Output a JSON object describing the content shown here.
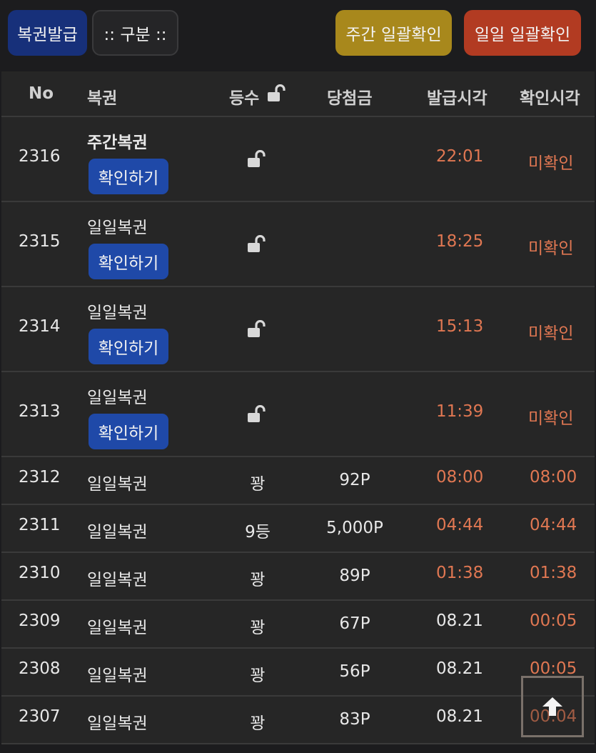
{
  "toolbar": {
    "issue_label": "복권발급",
    "category_label": ":: 구분 ::",
    "weekly_confirm_label": "주간 일괄확인",
    "daily_confirm_label": "일일 일괄확인"
  },
  "colors": {
    "issue_button": "#17307a",
    "weekly_button": "#a8881c",
    "daily_button": "#b23b22",
    "confirm_button": "#1f49a8",
    "accent_time": "#e07752"
  },
  "table": {
    "headers": {
      "no": "No",
      "ticket": "복권",
      "rank": "등수",
      "prize": "당첨금",
      "issued_at": "발급시각",
      "checked_at": "확인시각"
    },
    "unconfirmed_rows": [
      {
        "no": "2316",
        "type": "주간복권",
        "button": "확인하기",
        "rank_icon": "unlock-icon",
        "issued_at": "22:01",
        "checked_at": "미확인"
      },
      {
        "no": "2315",
        "type": "일일복권",
        "button": "확인하기",
        "rank_icon": "unlock-icon",
        "issued_at": "18:25",
        "checked_at": "미확인"
      },
      {
        "no": "2314",
        "type": "일일복권",
        "button": "확인하기",
        "rank_icon": "unlock-icon",
        "issued_at": "15:13",
        "checked_at": "미확인"
      },
      {
        "no": "2313",
        "type": "일일복권",
        "button": "확인하기",
        "rank_icon": "unlock-icon",
        "issued_at": "11:39",
        "checked_at": "미확인"
      }
    ],
    "rows": [
      {
        "no": "2312",
        "type": "일일복권",
        "rank": "꽝",
        "prize": "92P",
        "issued_at": "08:00",
        "checked_at": "08:00"
      },
      {
        "no": "2311",
        "type": "일일복권",
        "rank": "9등",
        "prize": "5,000P",
        "issued_at": "04:44",
        "checked_at": "04:44"
      },
      {
        "no": "2310",
        "type": "일일복권",
        "rank": "꽝",
        "prize": "89P",
        "issued_at": "01:38",
        "checked_at": "01:38"
      },
      {
        "no": "2309",
        "type": "일일복권",
        "rank": "꽝",
        "prize": "67P",
        "issued_at": "08.21",
        "checked_at": "00:05"
      },
      {
        "no": "2308",
        "type": "일일복권",
        "rank": "꽝",
        "prize": "56P",
        "issued_at": "08.21",
        "checked_at": "00:05"
      },
      {
        "no": "2307",
        "type": "일일복권",
        "rank": "꽝",
        "prize": "83P",
        "issued_at": "08.21",
        "checked_at": "00:04"
      }
    ]
  },
  "scroll_top_icon": "arrow-up-icon"
}
